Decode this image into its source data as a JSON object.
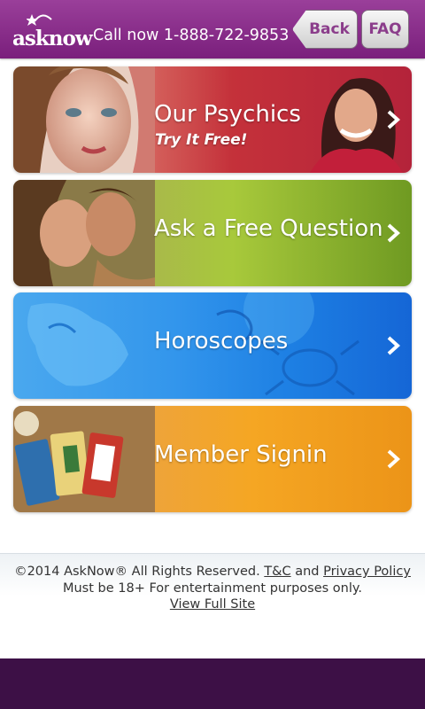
{
  "header": {
    "logo_text": "asknow",
    "call_text": "Call now 1-888-722-9853",
    "back_label": "Back",
    "faq_label": "FAQ"
  },
  "tiles": [
    {
      "label": "Our Psychics",
      "subtitle": "Try It Free!"
    },
    {
      "label": "Ask a Free Question"
    },
    {
      "label": "Horoscopes"
    },
    {
      "label": "Member Signin"
    }
  ],
  "footer": {
    "copyright": "©2014 AskNow® All Rights Reserved.",
    "tc_link": "T&C",
    "and_text": "and",
    "privacy_link": "Privacy Policy",
    "disclaimer": "Must be 18+ For entertainment purposes only.",
    "full_site_link": "View Full Site"
  },
  "colors": {
    "header": "#7a1f7c",
    "psychics_tile": "#c4313a",
    "question_tile": "#8fb52c",
    "horoscopes_tile": "#2b8ae8",
    "signin_tile": "#f2a02a",
    "bottom_bar": "#3d1046"
  },
  "icons": [
    "star-icon",
    "chevron-right-icon"
  ]
}
